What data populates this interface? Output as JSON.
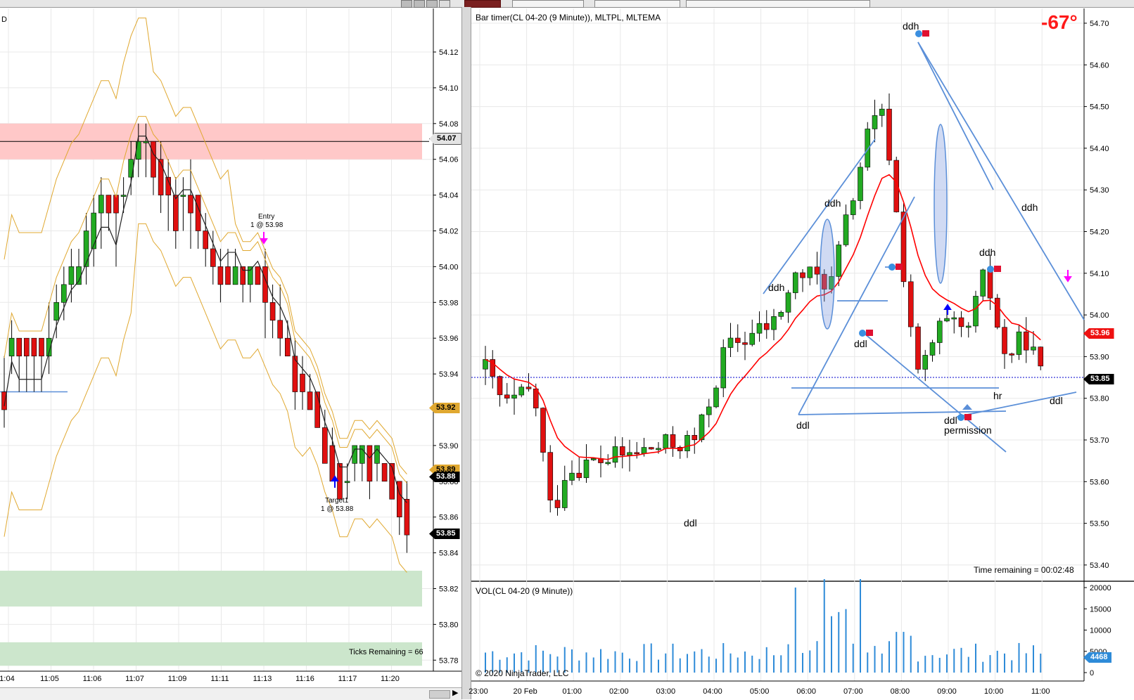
{
  "left_chart": {
    "corner_label": "D",
    "price_ticks": [
      "54.12",
      "54.10",
      "54.08",
      "54.06",
      "54.04",
      "54.02",
      "54.00",
      "53.98",
      "53.96",
      "53.94",
      "53.92",
      "53.90",
      "53.88",
      "53.86",
      "53.84",
      "53.82",
      "53.80",
      "53.78"
    ],
    "time_ticks": [
      "1:04",
      "11:05",
      "11:06",
      "11:07",
      "11:09",
      "11:11",
      "11:13",
      "11:16",
      "11:17",
      "11:20"
    ],
    "flags": {
      "top": "54.07",
      "gold": "53.92",
      "gold2": "53.89",
      "black1": "53.88",
      "black2": "53.85"
    },
    "entry_label": "Entry",
    "entry_detail": "1 @ 53.98",
    "target_label": "Target1",
    "target_detail": "1 @ 53.88",
    "ticks_remaining": "Ticks Remaining = 66",
    "colors": {
      "up": "#22aa22",
      "down": "#e01010",
      "bands": "#e0a830",
      "supply": "#ffc8c8",
      "demand": "#cce6cc"
    }
  },
  "right_chart": {
    "title": "Bar timer(CL 04-20 (9 Minute)), MLTPL, MLTEMA",
    "angle": "-67°",
    "price_ticks": [
      "54.70",
      "54.60",
      "54.50",
      "54.40",
      "54.30",
      "54.20",
      "54.10",
      "54.00",
      "53.90",
      "53.80",
      "53.70",
      "53.60",
      "53.50",
      "53.40"
    ],
    "time_ticks": [
      "23:00",
      "20 Feb",
      "01:00",
      "02:00",
      "03:00",
      "04:00",
      "05:00",
      "06:00",
      "07:00",
      "08:00",
      "09:00",
      "10:00",
      "11:00"
    ],
    "flags": {
      "red": "53.96",
      "black": "53.85"
    },
    "annotations": {
      "ddh_top": "ddh",
      "ddh_a": "ddh",
      "ddh_b": "ddh",
      "ddh_c": "ddh",
      "ddh_d": "ddh",
      "ddl_a": "ddl",
      "ddl_b": "ddl",
      "ddl_c": "ddl",
      "ddl_d": "ddl",
      "ddl_e": "ddl",
      "hr": "hr",
      "permission": "permission"
    },
    "time_remaining": "Time remaining = 00:02:48",
    "colors": {
      "up": "#22aa22",
      "down": "#e01010",
      "ema": "#ff0000",
      "lines": "#5b8fd8",
      "dotted": "#0000cc"
    }
  },
  "volume_chart": {
    "title": "VOL(CL 04-20 (9 Minute))",
    "ticks": [
      "20000",
      "15000",
      "10000",
      "5000",
      "0"
    ],
    "flag": "4468",
    "copyright": "© 2020 NinjaTrader, LLC",
    "bar_color": "#2e8bd8"
  }
}
